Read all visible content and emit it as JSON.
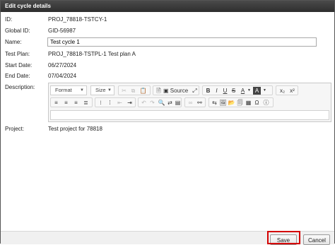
{
  "dialog": {
    "title": "Edit cycle details"
  },
  "fields": {
    "id_label": "ID:",
    "id_value": "PROJ_78818-TSTCY-1",
    "global_id_label": "Global ID:",
    "global_id_value": "GID-56987",
    "name_label": "Name:",
    "name_value": "Test cycle 1",
    "test_plan_label": "Test Plan:",
    "test_plan_value": "PROJ_78818-TSTPL-1 Test plan A",
    "start_date_label": "Start Date:",
    "start_date_value": "06/27/2024",
    "end_date_label": "End Date:",
    "end_date_value": "07/04/2024",
    "description_label": "Description:",
    "project_label": "Project:",
    "project_value": "Test project for 78818"
  },
  "editor": {
    "format_label": "Format",
    "size_label": "Size",
    "source_label": "Source",
    "bold_label": "B",
    "italic_label": "I",
    "underline_label": "U",
    "strike_label": "S",
    "text_color_label": "A",
    "bg_color_label": "A",
    "subscript_label": "x₂",
    "superscript_label": "x²",
    "omega_label": "Ω"
  },
  "buttons": {
    "save_label": "Save",
    "cancel_label": "Cancel"
  },
  "colors": {
    "titlebar": "#3a3a3a",
    "highlight": "#d40000"
  }
}
